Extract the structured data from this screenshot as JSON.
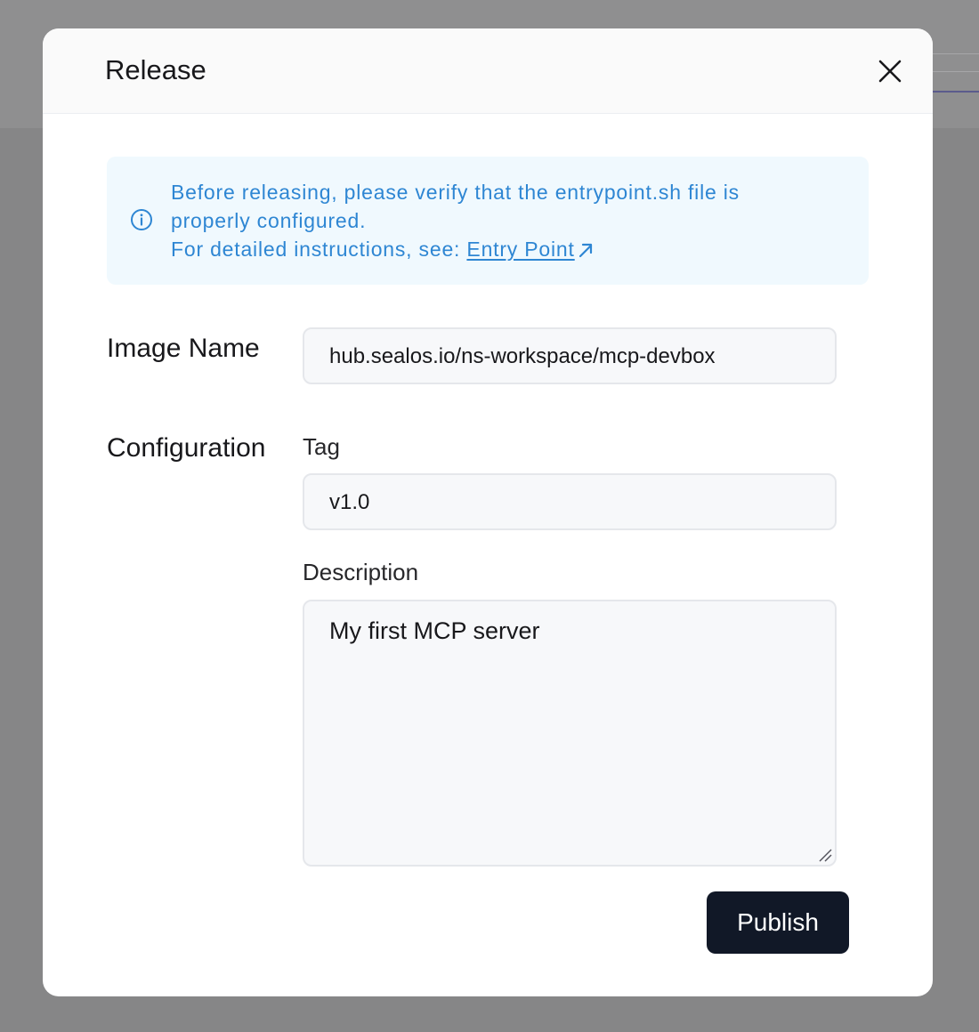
{
  "dialog": {
    "title": "Release"
  },
  "notice": {
    "line1": "Before releasing, please verify that the entrypoint.sh file is",
    "line2": "properly configured.",
    "line3_prefix": "For detailed instructions, see: ",
    "link_text": "Entry Point",
    "icon": "info-icon",
    "color": "#2e86d3",
    "background": "#f0f9fe"
  },
  "form": {
    "image_name_label": "Image Name",
    "image_name_value": "hub.sealos.io/ns-workspace/mcp-devbox",
    "configuration_label": "Configuration",
    "tag_label": "Tag",
    "tag_value": "v1.0",
    "description_label": "Description",
    "description_value": "My first MCP server"
  },
  "actions": {
    "publish_label": "Publish",
    "publish_color": "#111827"
  },
  "icons": {
    "close": "close-icon",
    "external_link": "external-link-icon",
    "resize": "resize-grip-icon"
  }
}
